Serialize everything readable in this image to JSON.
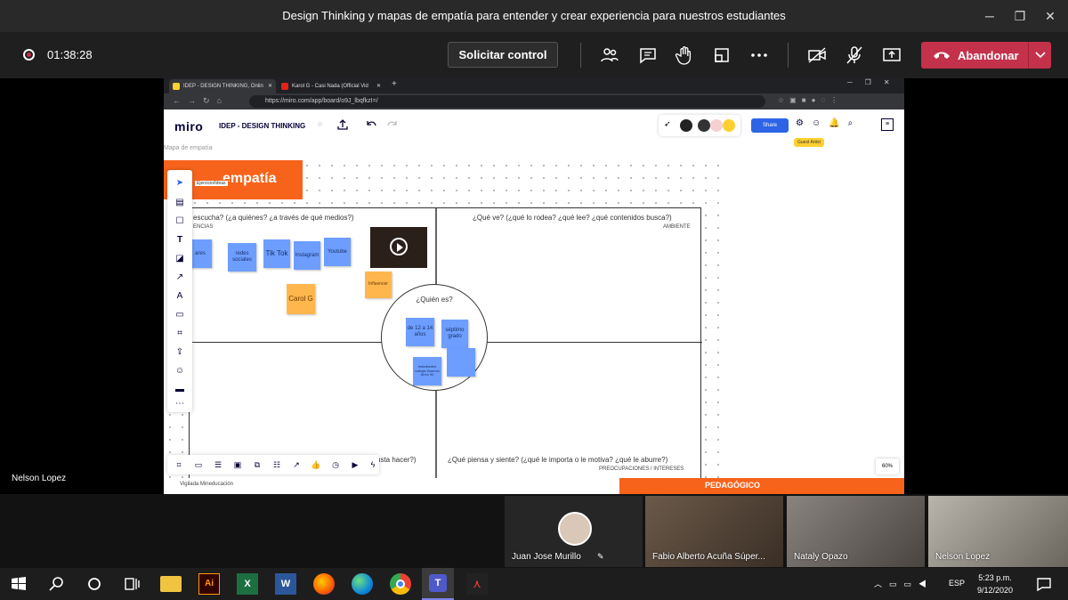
{
  "window": {
    "title": "Design Thinking y mapas de empatía para entender y crear experiencia para nuestros estudiantes"
  },
  "meeting": {
    "timer": "01:38:28",
    "request_control": "Solicitar control",
    "leave": "Abandonar"
  },
  "browser": {
    "tabs": [
      {
        "label": "IDEP - DESIGN THINKING, Onlin"
      },
      {
        "label": "Karol G - Casi Nada (Official Vid"
      }
    ],
    "url": "https://miro.com/app/board/o9J_lbqfkzI=/"
  },
  "miro": {
    "logo": "miro",
    "board_name": "IDEP - DESIGN THINKING",
    "share": "Share",
    "guest_badge": "Guest Artist",
    "breadcrumb": "Mapa de empatía",
    "zoom": "60%"
  },
  "map": {
    "header": "empatía",
    "section_tag": "Ejercicio/Ideas",
    "q_listen": "escucha? (¿a quiénes? ¿a través de qué medios?)",
    "q_listen_sub": "ENCIAS",
    "q_see": "¿Qué ve? (¿qué lo rodea? ¿qué lee? ¿qué contenidos busca?)",
    "q_see_sub": "AMBIENTE",
    "q_do": "usta hacer?)",
    "q_think": "¿Qué piensa y siente? (¿qué le importa o le motiva? ¿qué le aburre?)",
    "q_think_sub": "PREOCUPACIONES / INTERESES",
    "who": "¿Quién es?",
    "notes": {
      "n1": "ares",
      "n2": "redes sociales",
      "n3": "Tik Tok",
      "n4": "Instagram",
      "n5": "Youtube",
      "n6": "Carol G",
      "n7": "Influencer",
      "n8": "de 12 a 14 años",
      "n9": "séptimo grado",
      "n10": "estudiantes colegio Buenos Aires 90",
      "n11": ""
    },
    "footer": "Vigilada Mineducación",
    "footer_brand": "PEDAGÓGICO"
  },
  "presenter": "Nelson Lopez",
  "participants": [
    {
      "name": "Juan Jose Murillo"
    },
    {
      "name": "Fabio Alberto Acuña Súper..."
    },
    {
      "name": "Nataly Opazo"
    },
    {
      "name": "Nelson Lopez"
    }
  ],
  "tray": {
    "lang": "ESP",
    "time": "5:23 p.m.",
    "date": "9/12/2020"
  },
  "colors": {
    "leave": "#c4314b",
    "miro_orange": "#f7631b",
    "sticky_blue": "#6d9eff",
    "sticky_orange": "#ffb74d"
  }
}
